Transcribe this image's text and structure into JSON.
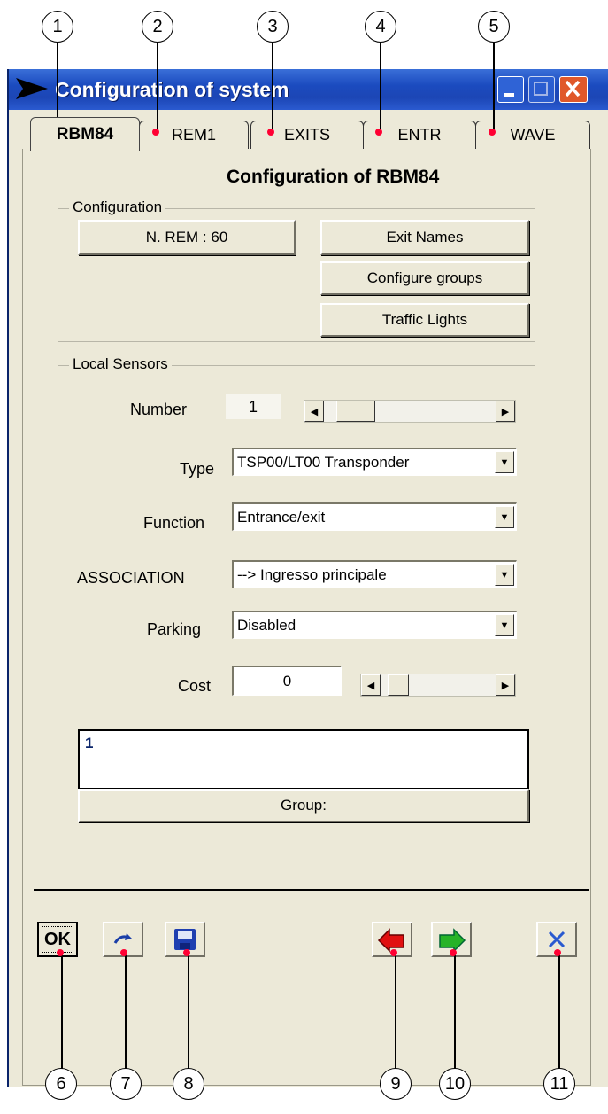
{
  "window": {
    "title": "Configuration of system"
  },
  "tabs": [
    {
      "label": "RBM84",
      "active": true
    },
    {
      "label": "REM1"
    },
    {
      "label": "EXITS"
    },
    {
      "label": "ENTR"
    },
    {
      "label": "WAVE"
    }
  ],
  "heading": "Configuration of RBM84",
  "configuration": {
    "legend": "Configuration",
    "nrem_button": "N. REM : 60",
    "exit_names_button": "Exit Names",
    "configure_groups_button": "Configure groups",
    "traffic_lights_button": "Traffic Lights"
  },
  "local_sensors": {
    "legend": "Local Sensors",
    "number_label": "Number",
    "number_value": "1",
    "type_label": "Type",
    "type_value": "TSP00/LT00 Transponder",
    "function_label": "Function",
    "function_value": "Entrance/exit",
    "association_label": "ASSOCIATION",
    "association_value": "--> Ingresso principale",
    "parking_label": "Parking",
    "parking_value": "Disabled",
    "cost_label": "Cost",
    "cost_value": "0",
    "list_items": [
      "1"
    ],
    "group_button": "Group:"
  },
  "toolbar": {
    "ok_label": "OK"
  },
  "callouts": [
    "1",
    "2",
    "3",
    "4",
    "5",
    "6",
    "7",
    "8",
    "9",
    "10",
    "11"
  ],
  "colors": {
    "titlebar": "#1c46b5",
    "window_bg": "#ece9d8",
    "callout_dot": "#ff0033",
    "close": "#e0582a"
  }
}
